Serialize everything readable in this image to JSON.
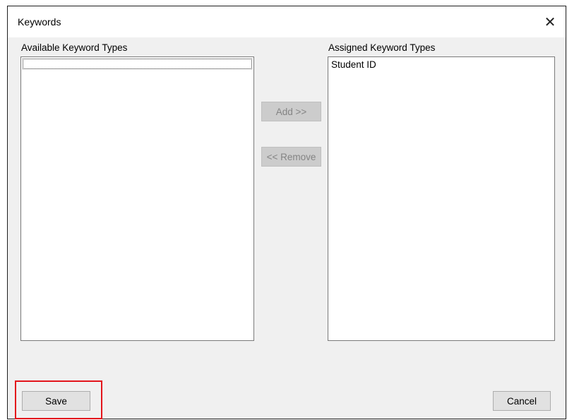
{
  "window": {
    "title": "Keywords",
    "close_glyph": "✕"
  },
  "available": {
    "label": "Available Keyword Types",
    "items": []
  },
  "assigned": {
    "label": "Assigned Keyword Types",
    "items": [
      "Student ID"
    ]
  },
  "buttons": {
    "add": "Add >>",
    "remove": "<< Remove",
    "save": "Save",
    "cancel": "Cancel"
  },
  "colors": {
    "highlight": "#e3141b",
    "disabled_text": "#838383"
  }
}
